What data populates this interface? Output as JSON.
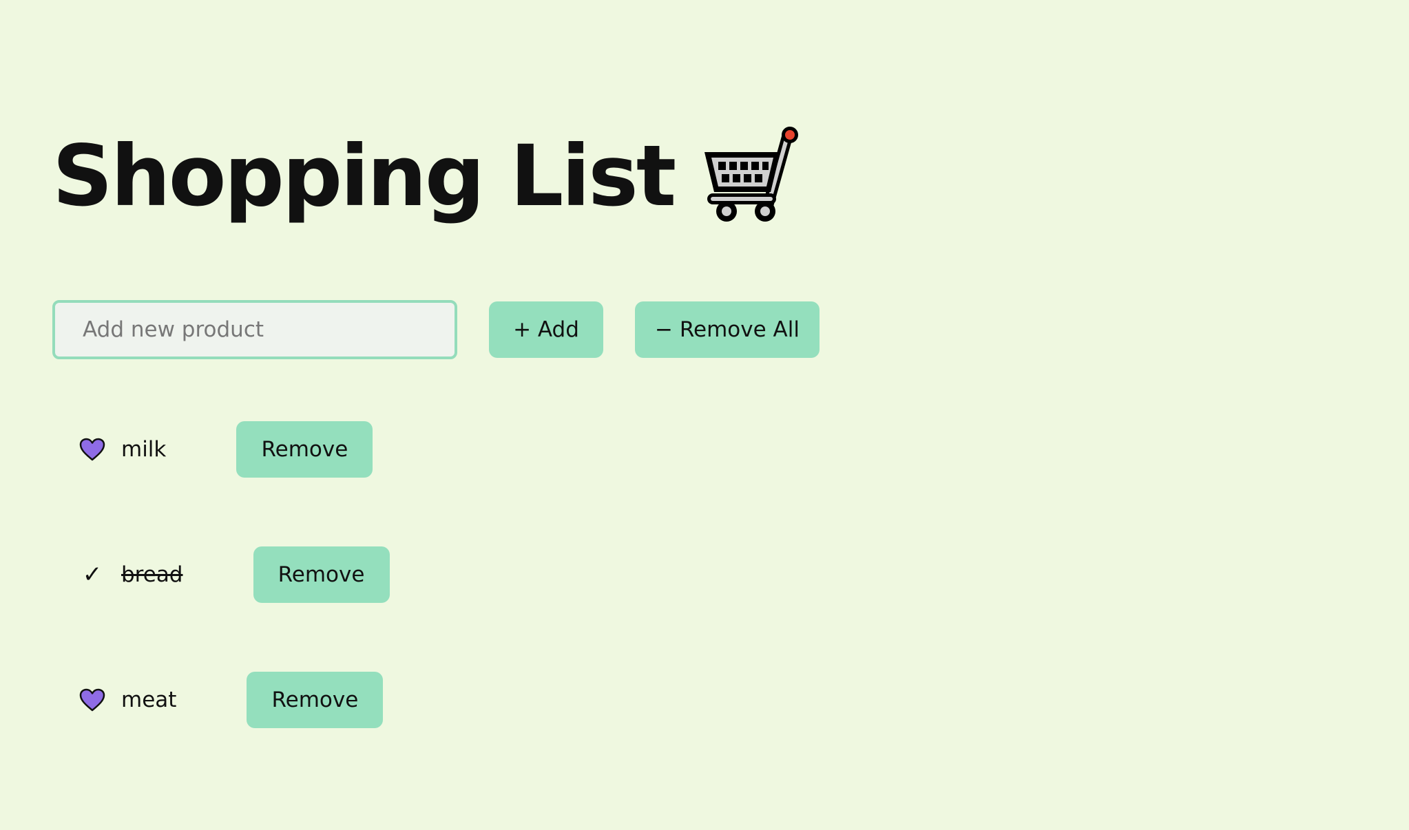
{
  "header": {
    "title": "Shopping List",
    "title_icon": "shopping-cart-icon"
  },
  "form": {
    "input_placeholder": "Add new product",
    "input_value": "",
    "add_label": "+ Add",
    "remove_all_label": "− Remove All"
  },
  "items": [
    {
      "name": "milk",
      "done": false,
      "status_icon": "purple-heart-icon",
      "remove_label": "Remove"
    },
    {
      "name": "bread",
      "done": true,
      "status_icon": "check-mark-icon",
      "status_text": "✓",
      "remove_label": "Remove"
    },
    {
      "name": "meat",
      "done": false,
      "status_icon": "purple-heart-icon",
      "remove_label": "Remove"
    }
  ],
  "colors": {
    "background": "#eff8e0",
    "accent": "#94dfbd",
    "input_border": "#94dcbb",
    "heart": "#8f6ce6"
  }
}
